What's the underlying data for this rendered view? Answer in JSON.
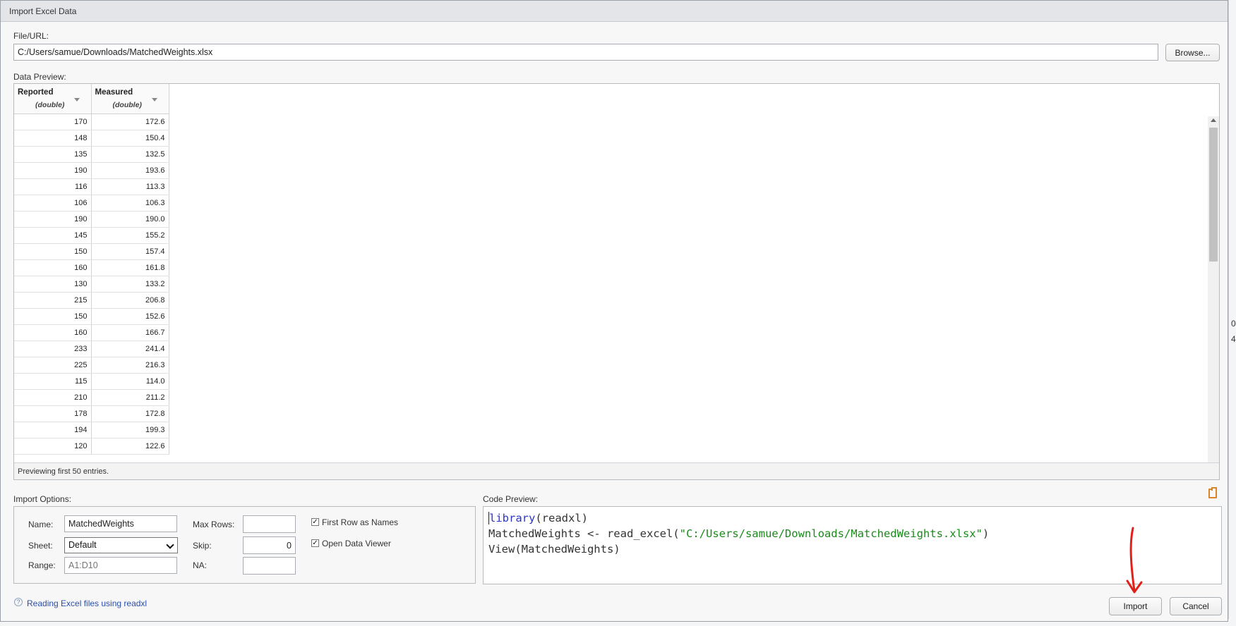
{
  "dialog": {
    "title": "Import Excel Data"
  },
  "file": {
    "label": "File/URL:",
    "value": "C:/Users/samue/Downloads/MatchedWeights.xlsx",
    "browse_label": "Browse..."
  },
  "preview": {
    "label": "Data Preview:",
    "columns": [
      {
        "name": "Reported",
        "type": "(double)"
      },
      {
        "name": "Measured",
        "type": "(double)"
      }
    ],
    "rows": [
      [
        "170",
        "172.6"
      ],
      [
        "148",
        "150.4"
      ],
      [
        "135",
        "132.5"
      ],
      [
        "190",
        "193.6"
      ],
      [
        "116",
        "113.3"
      ],
      [
        "106",
        "106.3"
      ],
      [
        "190",
        "190.0"
      ],
      [
        "145",
        "155.2"
      ],
      [
        "150",
        "157.4"
      ],
      [
        "160",
        "161.8"
      ],
      [
        "130",
        "133.2"
      ],
      [
        "215",
        "206.8"
      ],
      [
        "150",
        "152.6"
      ],
      [
        "160",
        "166.7"
      ],
      [
        "233",
        "241.4"
      ],
      [
        "225",
        "216.3"
      ],
      [
        "115",
        "114.0"
      ],
      [
        "210",
        "211.2"
      ],
      [
        "178",
        "172.8"
      ],
      [
        "194",
        "199.3"
      ],
      [
        "120",
        "122.6"
      ]
    ],
    "footer": "Previewing first 50 entries."
  },
  "options": {
    "label": "Import Options:",
    "name_label": "Name:",
    "name_value": "MatchedWeights",
    "sheet_label": "Sheet:",
    "sheet_value": "Default",
    "range_label": "Range:",
    "range_placeholder": "A1:D10",
    "maxrows_label": "Max Rows:",
    "maxrows_value": "",
    "skip_label": "Skip:",
    "skip_value": "0",
    "na_label": "NA:",
    "na_value": "",
    "first_row_label": "First Row as Names",
    "first_row_checked": true,
    "open_viewer_label": "Open Data Viewer",
    "open_viewer_checked": true
  },
  "code": {
    "label": "Code Preview:",
    "line1_kw": "library",
    "line1_rest": "(readxl)",
    "line2_pre": "MatchedWeights <- read_excel(",
    "line2_str": "\"C:/Users/samue/Downloads/MatchedWeights.xlsx\"",
    "line2_post": ")",
    "line3": "View(MatchedWeights)"
  },
  "footer": {
    "help_icon": "?",
    "help_link": "Reading Excel files using readxl",
    "import_label": "Import",
    "cancel_label": "Cancel"
  },
  "background": {
    "frag1": "0:",
    "frag2": "4"
  },
  "colors": {
    "annotation_arrow": "#e0211a",
    "code_keyword": "#2c35c9",
    "code_string": "#1a8a1a"
  }
}
